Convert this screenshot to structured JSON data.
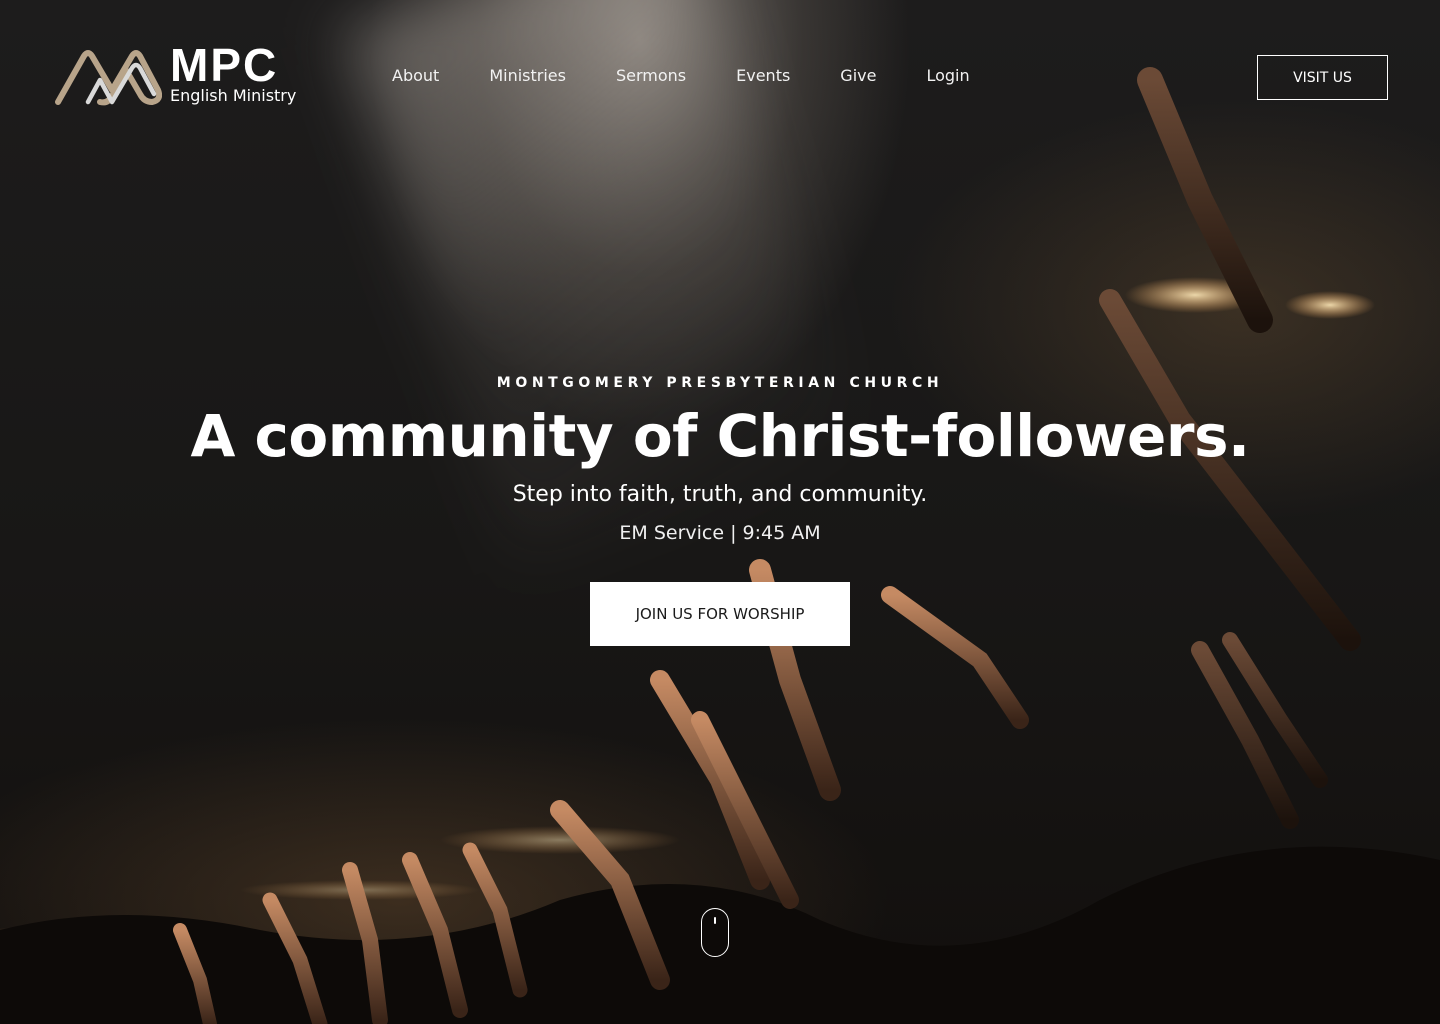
{
  "logo": {
    "title": "MPC",
    "subtitle": "English Ministry"
  },
  "nav": {
    "items": [
      "About",
      "Ministries",
      "Sermons",
      "Events",
      "Give",
      "Login"
    ]
  },
  "header": {
    "visit_label": "VISIT US"
  },
  "hero": {
    "eyebrow": "MONTGOMERY PRESBYTERIAN CHURCH",
    "headline": "A community of Christ-followers.",
    "tagline": "Step into faith, truth, and community.",
    "service_time": "EM Service | 9:45 AM",
    "cta_label": "JOIN US FOR WORSHIP"
  },
  "colors": {
    "accent_gold": "#b8a48a",
    "logo_inner": "#d9d9d9",
    "background": "#161616"
  },
  "icons": {
    "scroll": "mouse-scroll-icon"
  }
}
